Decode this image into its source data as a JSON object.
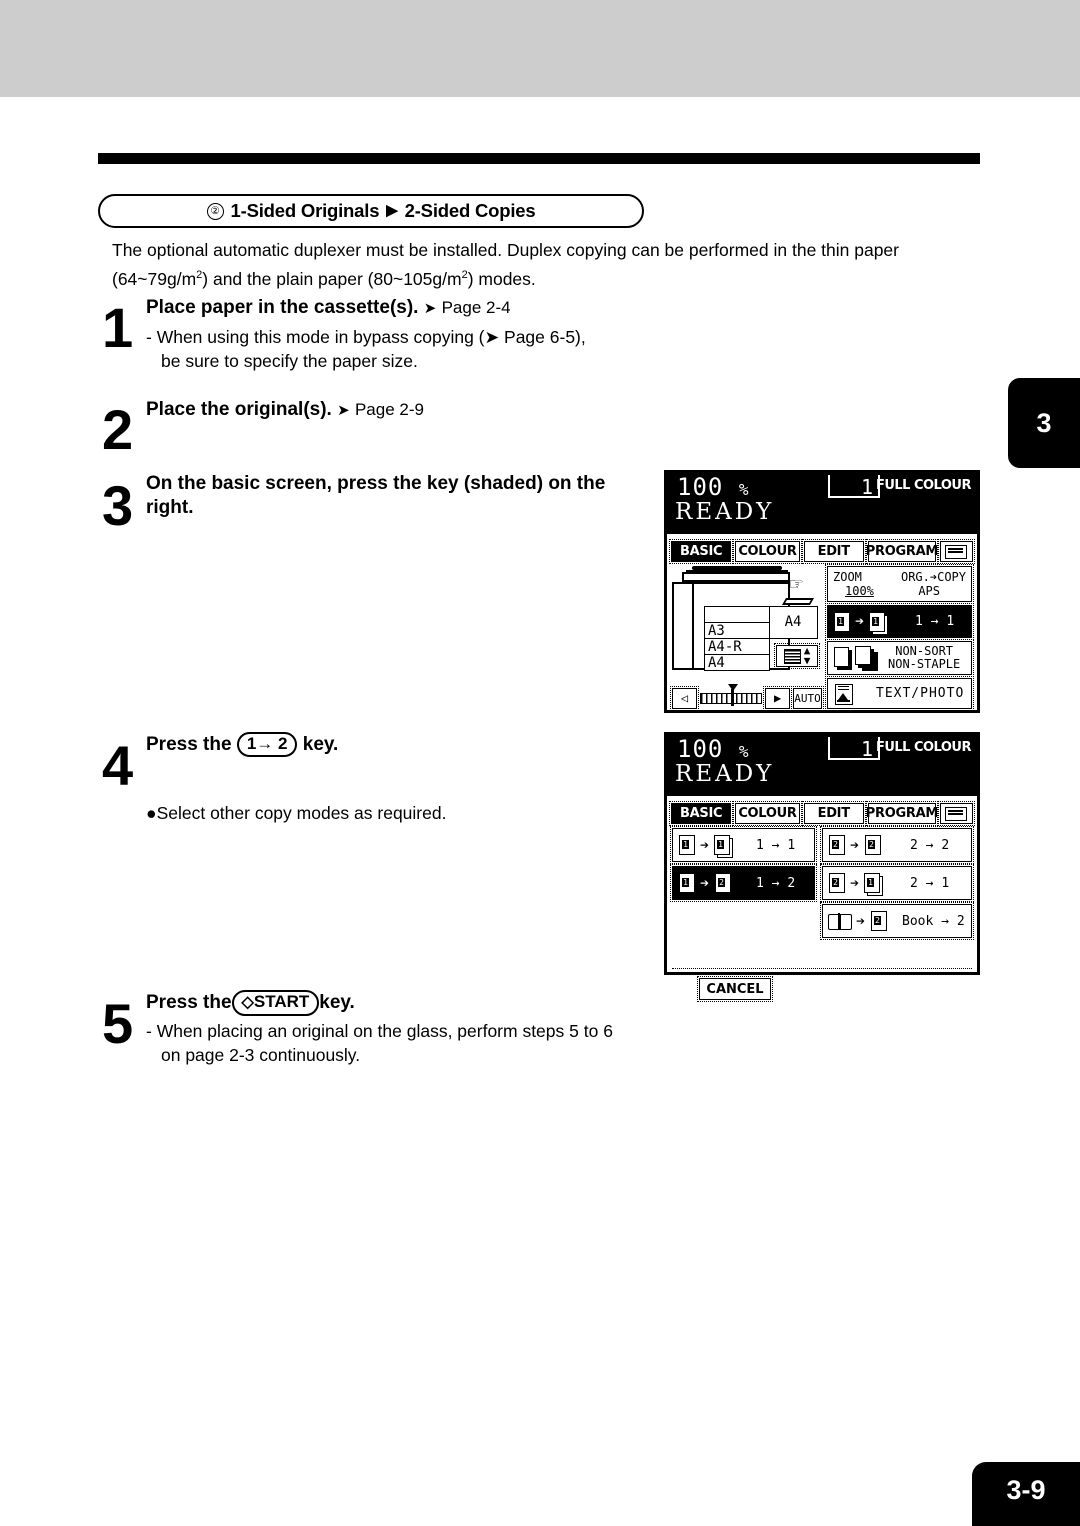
{
  "page": {
    "side_tab": "3",
    "footer": "3-9"
  },
  "section": {
    "marker": "②",
    "title_a": "1-Sided Originals",
    "triangle": "▶",
    "title_b": "2-Sided Copies"
  },
  "intro": {
    "line1": "The optional automatic duplexer must be installed.  Duplex copying can be performed in the thin paper",
    "line2_a": "(64~79g/m",
    "line2_sup1": "2",
    "line2_b": ") and the plain paper (80~105g/m",
    "line2_sup2": "2",
    "line2_c": ") modes."
  },
  "steps": [
    {
      "num": "1",
      "head": "Place paper in the cassette(s).",
      "head_arrow": "➤",
      "head_page": "Page 2-4",
      "body_line1": "-  When using this mode in bypass copying (➤ Page 6-5),",
      "body_line2": "be sure to specify the paper size."
    },
    {
      "num": "2",
      "head": "Place the original(s).",
      "head_arrow": "➤",
      "head_page": "Page 2-9"
    },
    {
      "num": "3",
      "head_line1": "On the basic screen, press the key (shaded) on the",
      "head_line2": "right."
    },
    {
      "num": "4",
      "head_pre": "Press the",
      "keycap": "1→ 2",
      "head_post": "key.",
      "bullet": "●Select other copy modes as required."
    },
    {
      "num": "5",
      "head_pre": "Press the",
      "keycap_icon": "◊",
      "keycap": "START",
      "head_post": "key.",
      "body_line1": "-  When placing an original on the glass, perform steps 5 to 6",
      "body_line2": "on page 2-3 continuously."
    }
  ],
  "lcd1": {
    "percent": "100",
    "percent_unit": "%",
    "count": "1",
    "colour_mode": "FULL COLOUR",
    "status": "READY",
    "tabs": [
      {
        "label": "BASIC",
        "selected": true
      },
      {
        "label": "COLOUR",
        "selected": false
      },
      {
        "label": "EDIT",
        "selected": false
      },
      {
        "label": "PROGRAM",
        "selected": false
      },
      {
        "label": "",
        "selected": false,
        "icon": "keyboard-icon"
      }
    ],
    "cassettes": [
      "",
      "A3",
      "A4-R",
      "A4"
    ],
    "bypass_size": "A4",
    "density_auto": "AUTO",
    "zoom_label": "ZOOM",
    "zoom_value": "100%",
    "org_copy_label": "ORG.➔COPY",
    "org_copy_value": "APS",
    "duplex_label": "1 → 1",
    "finish_label_1": "NON-SORT",
    "finish_label_2": "NON-STAPLE",
    "original_mode": "TEXT/PHOTO"
  },
  "lcd2": {
    "percent": "100",
    "percent_unit": "%",
    "count": "1",
    "colour_mode": "FULL COLOUR",
    "status": "READY",
    "tabs": [
      {
        "label": "BASIC",
        "selected": true
      },
      {
        "label": "COLOUR",
        "selected": false
      },
      {
        "label": "EDIT",
        "selected": false
      },
      {
        "label": "PROGRAM",
        "selected": false
      },
      {
        "label": "",
        "selected": false,
        "icon": "keyboard-icon"
      }
    ],
    "options_left": [
      {
        "label": "1 → 1",
        "selected": false
      },
      {
        "label": "1 → 2",
        "selected": true
      }
    ],
    "options_right": [
      {
        "label": "2 → 2",
        "selected": false
      },
      {
        "label": "2 → 1",
        "selected": false
      },
      {
        "label": "Book → 2",
        "selected": false
      }
    ],
    "cancel_label": "CANCEL"
  }
}
